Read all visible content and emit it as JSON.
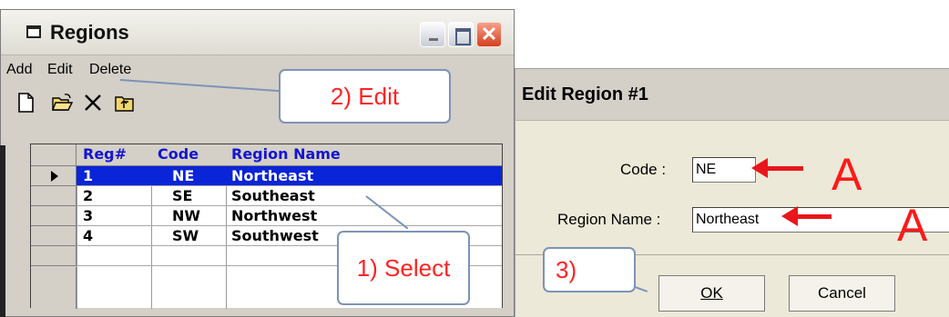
{
  "regions_window": {
    "title": "Regions",
    "menu": {
      "add": "Add",
      "edit": "Edit",
      "delete": "Delete"
    },
    "toolbar_icons": [
      "new-icon",
      "open-icon",
      "delete-icon",
      "up-folder-icon"
    ],
    "grid": {
      "headers": {
        "reg": "Reg#",
        "code": "Code",
        "name": "Region Name"
      },
      "rows": [
        {
          "reg": "1",
          "code": "NE",
          "name": "Northeast"
        },
        {
          "reg": "2",
          "code": "SE",
          "name": "Southeast"
        },
        {
          "reg": "3",
          "code": "NW",
          "name": "Northwest"
        },
        {
          "reg": "4",
          "code": "SW",
          "name": "Southwest"
        }
      ],
      "selected_row": 0
    }
  },
  "callouts": {
    "select": "1) Select",
    "edit": "2) Edit",
    "ok": "3)"
  },
  "edit_dialog": {
    "title": "Edit Region #1",
    "code_label": "Code :",
    "code_value": "NE",
    "name_label": "Region Name :",
    "name_value": "Northeast",
    "ok": "OK",
    "cancel": "Cancel",
    "annotation_letter": "A"
  },
  "colors": {
    "selection": "#0a24d8",
    "header_text": "#1414d2",
    "annotation_red": "#e8161b",
    "callout_border": "#7d93b7"
  }
}
